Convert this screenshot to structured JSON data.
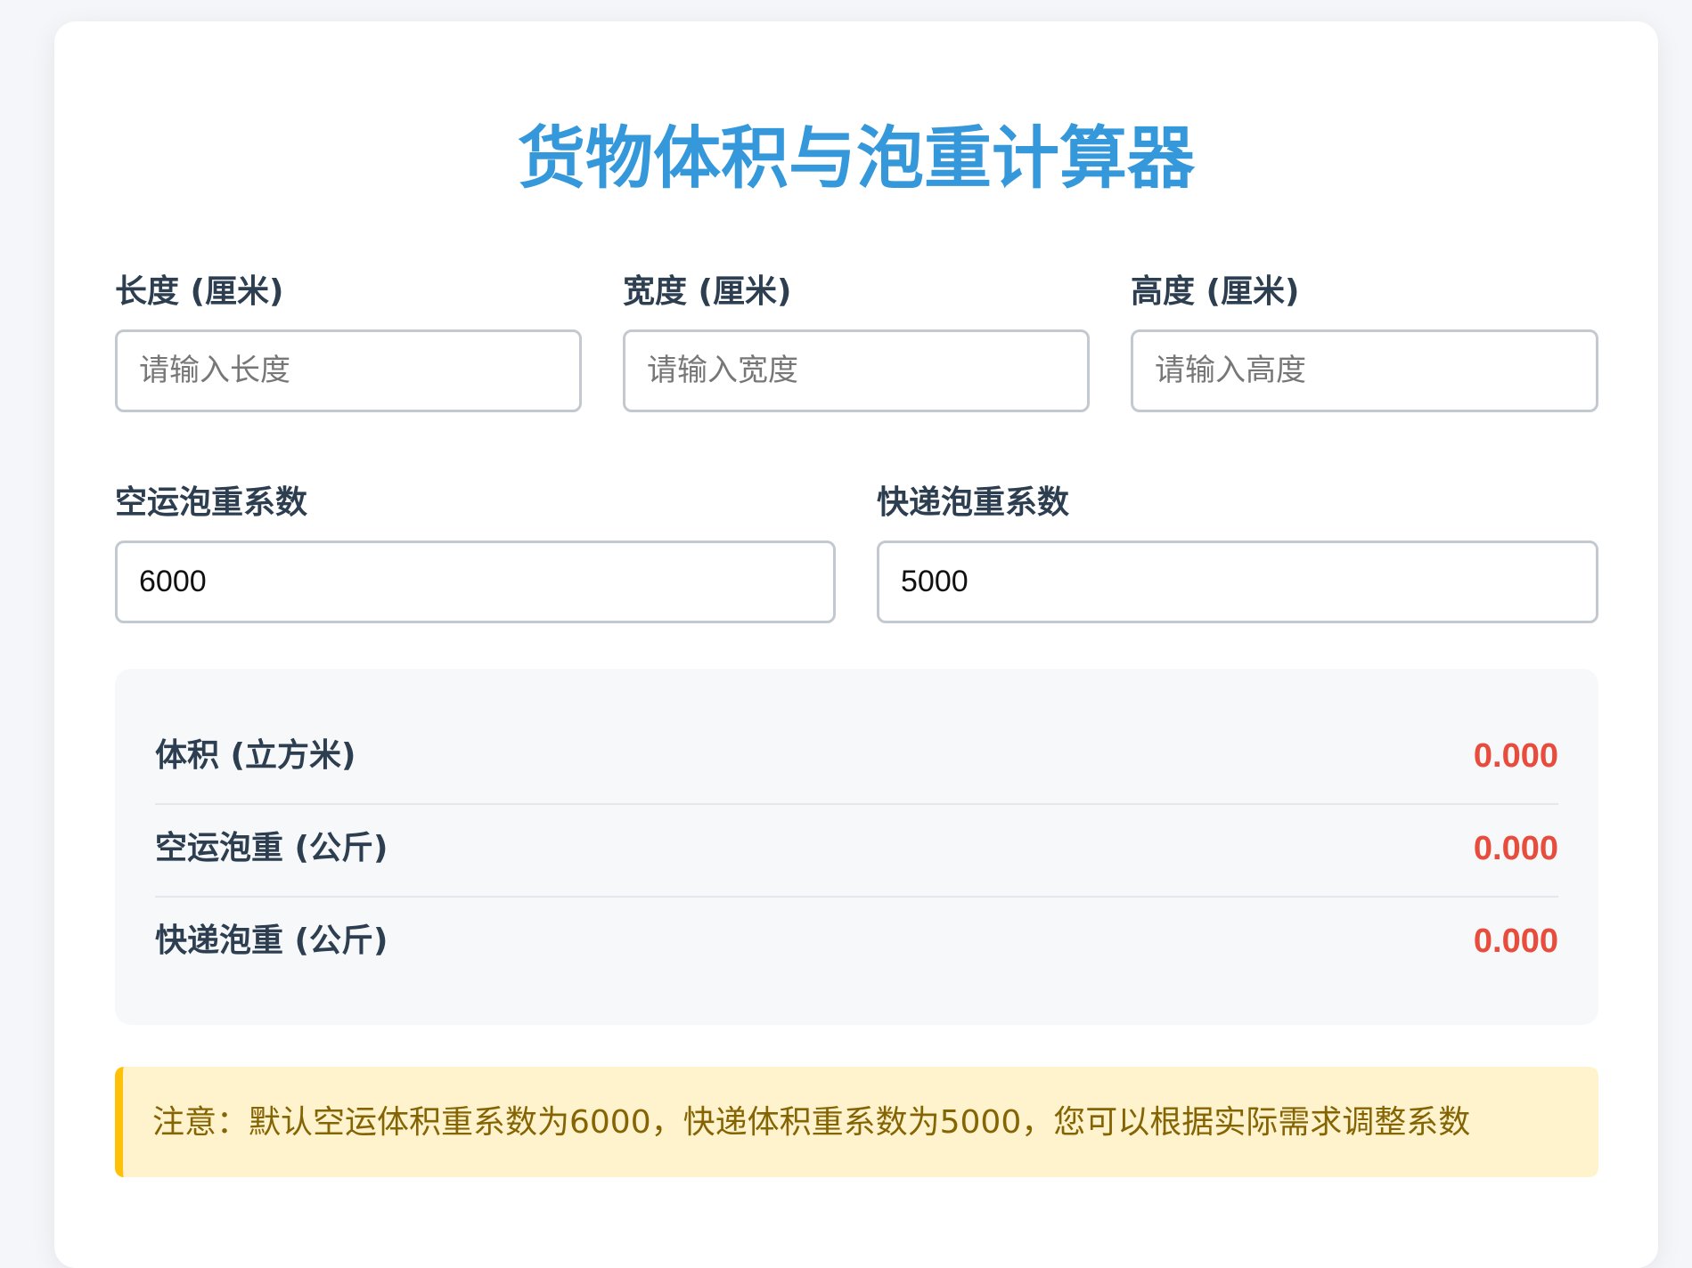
{
  "title": "货物体积与泡重计算器",
  "dimensions": {
    "length": {
      "label": "长度 (厘米)",
      "placeholder": "请输入长度",
      "value": ""
    },
    "width": {
      "label": "宽度 (厘米)",
      "placeholder": "请输入宽度",
      "value": ""
    },
    "height": {
      "label": "高度 (厘米)",
      "placeholder": "请输入高度",
      "value": ""
    }
  },
  "coefficients": {
    "air": {
      "label": "空运泡重系数",
      "value": "6000"
    },
    "express": {
      "label": "快递泡重系数",
      "value": "5000"
    }
  },
  "results": [
    {
      "label": "体积 (立方米)",
      "value": "0.000"
    },
    {
      "label": "空运泡重 (公斤)",
      "value": "0.000"
    },
    {
      "label": "快递泡重 (公斤)",
      "value": "0.000"
    }
  ],
  "note": "注意：默认空运体积重系数为6000，快递体积重系数为5000，您可以根据实际需求调整系数",
  "colors": {
    "title": "#3498db",
    "result_value": "#e74c3c",
    "note_background": "#fff3cd",
    "note_border": "#ffc107",
    "note_text": "#856404"
  }
}
